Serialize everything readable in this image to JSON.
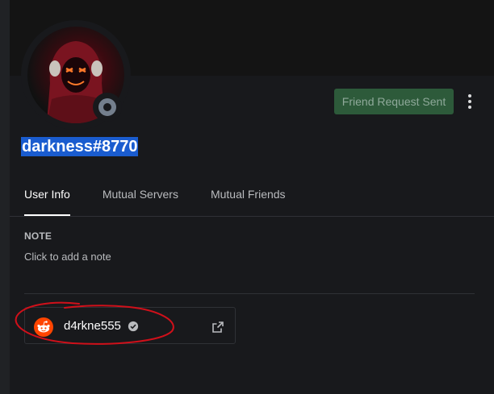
{
  "profile": {
    "username": "darkness#8770",
    "status": "offline",
    "avatar": "hooded-figure-neon-mask"
  },
  "actions": {
    "friend_button_label": "Friend Request Sent",
    "more_icon": "more-vertical-icon"
  },
  "tabs": [
    {
      "label": "User Info",
      "active": true
    },
    {
      "label": "Mutual Servers",
      "active": false
    },
    {
      "label": "Mutual Friends",
      "active": false
    }
  ],
  "note": {
    "heading": "NOTE",
    "placeholder": "Click to add a note"
  },
  "connections": [
    {
      "platform_icon": "reddit-icon",
      "name": "d4rkne555",
      "verified": true,
      "link_icon": "external-link-icon"
    }
  ],
  "colors": {
    "background": "#18191c",
    "banner": "#141414",
    "friend_button_bg": "#2d5a3a",
    "username_highlight": "#1a5ccf",
    "status_offline": "#747f8d",
    "reddit_orange": "#ff4500",
    "annotation_red": "#d0101a"
  }
}
